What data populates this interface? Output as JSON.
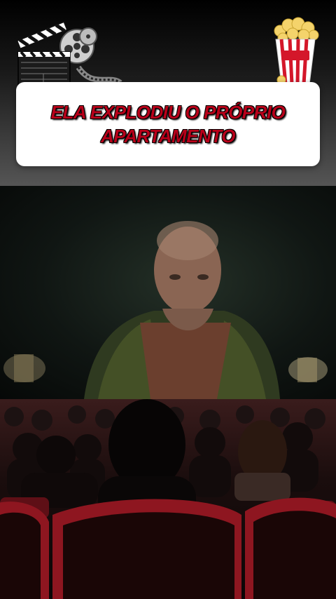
{
  "title": {
    "line1": "ELA EXPLODIU O PRÓPRIO",
    "line2": "APARTAMENTO"
  },
  "icons": {
    "clapperboard": "clapperboard-icon",
    "film_reel": "film-reel-icon",
    "popcorn": "popcorn-icon"
  },
  "colors": {
    "title_text": "#b8001a",
    "card_bg": "#ffffff",
    "seat_red": "#8e1620"
  }
}
